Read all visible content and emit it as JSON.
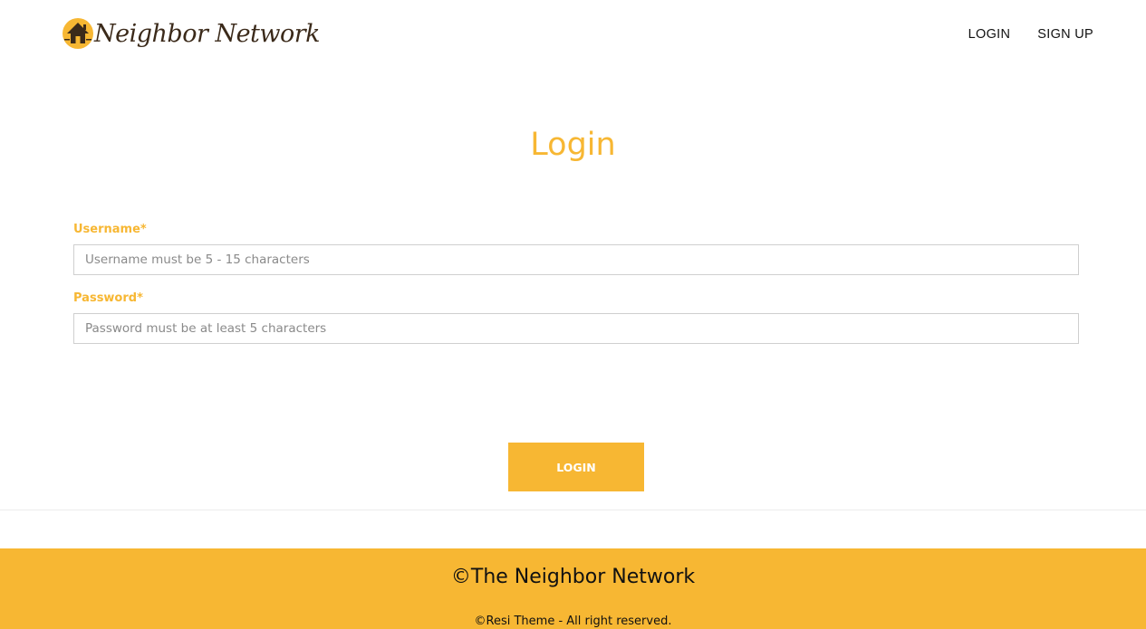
{
  "header": {
    "brand": "Neighbor Network",
    "logo_icon": "house-icon",
    "nav": {
      "login": "LOGIN",
      "signup": "SIGN UP"
    }
  },
  "main": {
    "title": "Login",
    "username": {
      "label": "Username*",
      "placeholder": "Username must be 5 - 15 characters",
      "value": ""
    },
    "password": {
      "label": "Password*",
      "placeholder": "Password must be at least 5 characters",
      "value": ""
    },
    "submit_label": "LOGIN"
  },
  "footer": {
    "title": "©The Neighbor Network",
    "copyright": "©Resi Theme - All right reserved."
  },
  "colors": {
    "accent": "#f7b733",
    "brand_text": "#3b2a1a",
    "background": "#ffffff"
  }
}
